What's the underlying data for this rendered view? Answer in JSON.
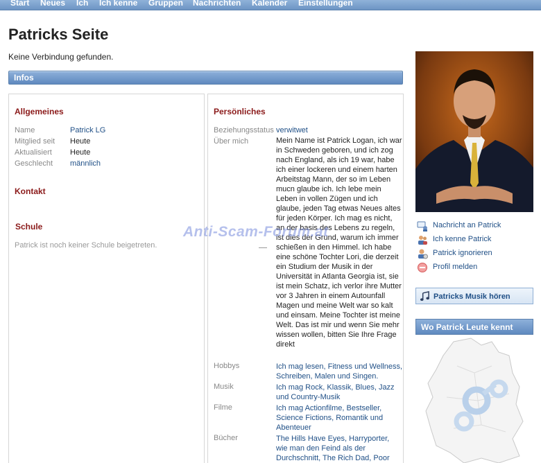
{
  "nav": [
    "Start",
    "Neues",
    "Ich",
    "Ich kenne",
    "Gruppen",
    "Nachrichten",
    "Kalender",
    "Einstellungen"
  ],
  "page": {
    "title": "Patricks Seite",
    "subtitle": "Keine Verbindung gefunden."
  },
  "infos_label": "Infos",
  "general": {
    "heading": "Allgemeines",
    "rows": [
      {
        "label": "Name",
        "value": "Patrick LG"
      },
      {
        "label": "Mitglied seit",
        "value": "Heute"
      },
      {
        "label": "Aktualisiert",
        "value": "Heute"
      },
      {
        "label": "Geschlecht",
        "value": "männlich"
      }
    ]
  },
  "contact_heading": "Kontakt",
  "school": {
    "heading": "Schule",
    "note": "Patrick ist noch keiner Schule beigetreten."
  },
  "personal": {
    "heading": "Persönliches",
    "status_label": "Beziehungsstatus",
    "status_value": "verwitwet",
    "about_label": "Über mich",
    "about_text": "Mein Name ist Patrick Logan, ich war in Schweden geboren, und ich zog nach England, als ich 19 war, habe ich einer lockeren und einem harten Arbeitstag Mann, der so im Leben mucn glaube ich. Ich lebe mein Leben in vollen Zügen und ich glaube, jeden Tag etwas Neues altes für jeden Körper. Ich mag es nicht, an der basis des Lebens zu regeln, ist dies der Grund, warum ich immer schießen in den Himmel. Ich habe eine schöne Tochter Lori, die derzeit ein Studium der Musik in der Universität in Atlanta Georgia ist, sie ist mein Schatz, ich verlor ihre Mutter vor 3 Jahren in einem Autounfall Magen und meine Welt war so kalt und einsam. Meine Tochter ist meine Welt. Das ist mir und wenn Sie mehr wissen wollen, bitten Sie Ihre Frage direkt",
    "hobbies_label": "Hobbys",
    "hobbies": "Ich mag lesen, Fitness und Wellness, Schreiben, Malen und Singen.",
    "music_label": "Musik",
    "music": "Ich mag Rock, Klassik, Blues, Jazz und Country-Musik",
    "films_label": "Filme",
    "films": "Ich mag Actionfilme, Bestseller, Science Fictions, Romantik und Abenteuer",
    "books_label": "Bücher",
    "books": "The Hills Have Eyes, Harryporter, wie man den Feind als der Durchschnitt, The Rich Dad, Poor"
  },
  "watermark": "Anti-Scam-Forum.at",
  "actions": [
    {
      "label": "Nachricht an Patrick",
      "icon": "message-icon"
    },
    {
      "label": "Ich kenne Patrick",
      "icon": "add-friend-icon"
    },
    {
      "label": "Patrick ignorieren",
      "icon": "ignore-user-icon"
    },
    {
      "label": "Profil melden",
      "icon": "report-icon"
    }
  ],
  "music_button": "Patricks Musik hören",
  "map_title": "Wo Patrick Leute kennt",
  "colors": {
    "accent": "#5f89bf",
    "heading": "#8b1a1a",
    "link": "#1f4f86"
  }
}
